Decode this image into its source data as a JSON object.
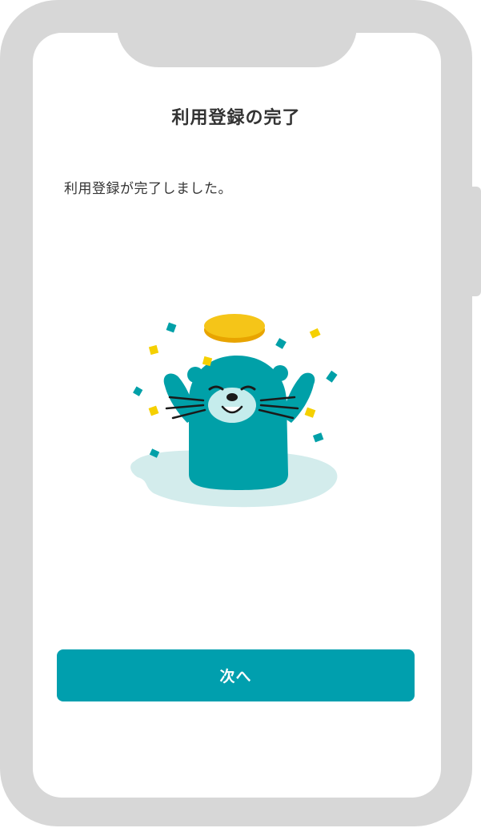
{
  "header": {
    "title": "利用登録の完了"
  },
  "main": {
    "message": "利用登録が完了しました。",
    "illustration": "otter-celebrating-with-coin-and-confetti"
  },
  "footer": {
    "next_label": "次へ"
  },
  "colors": {
    "accent": "#009fae",
    "otter": "#00a0a8",
    "otter_face": "#c5ecec",
    "coin": "#f5c518",
    "confetti_yellow": "#f5d000",
    "confetti_teal": "#00a0a8",
    "puddle": "#d3ecec",
    "device_frame": "#d7d7d7"
  }
}
